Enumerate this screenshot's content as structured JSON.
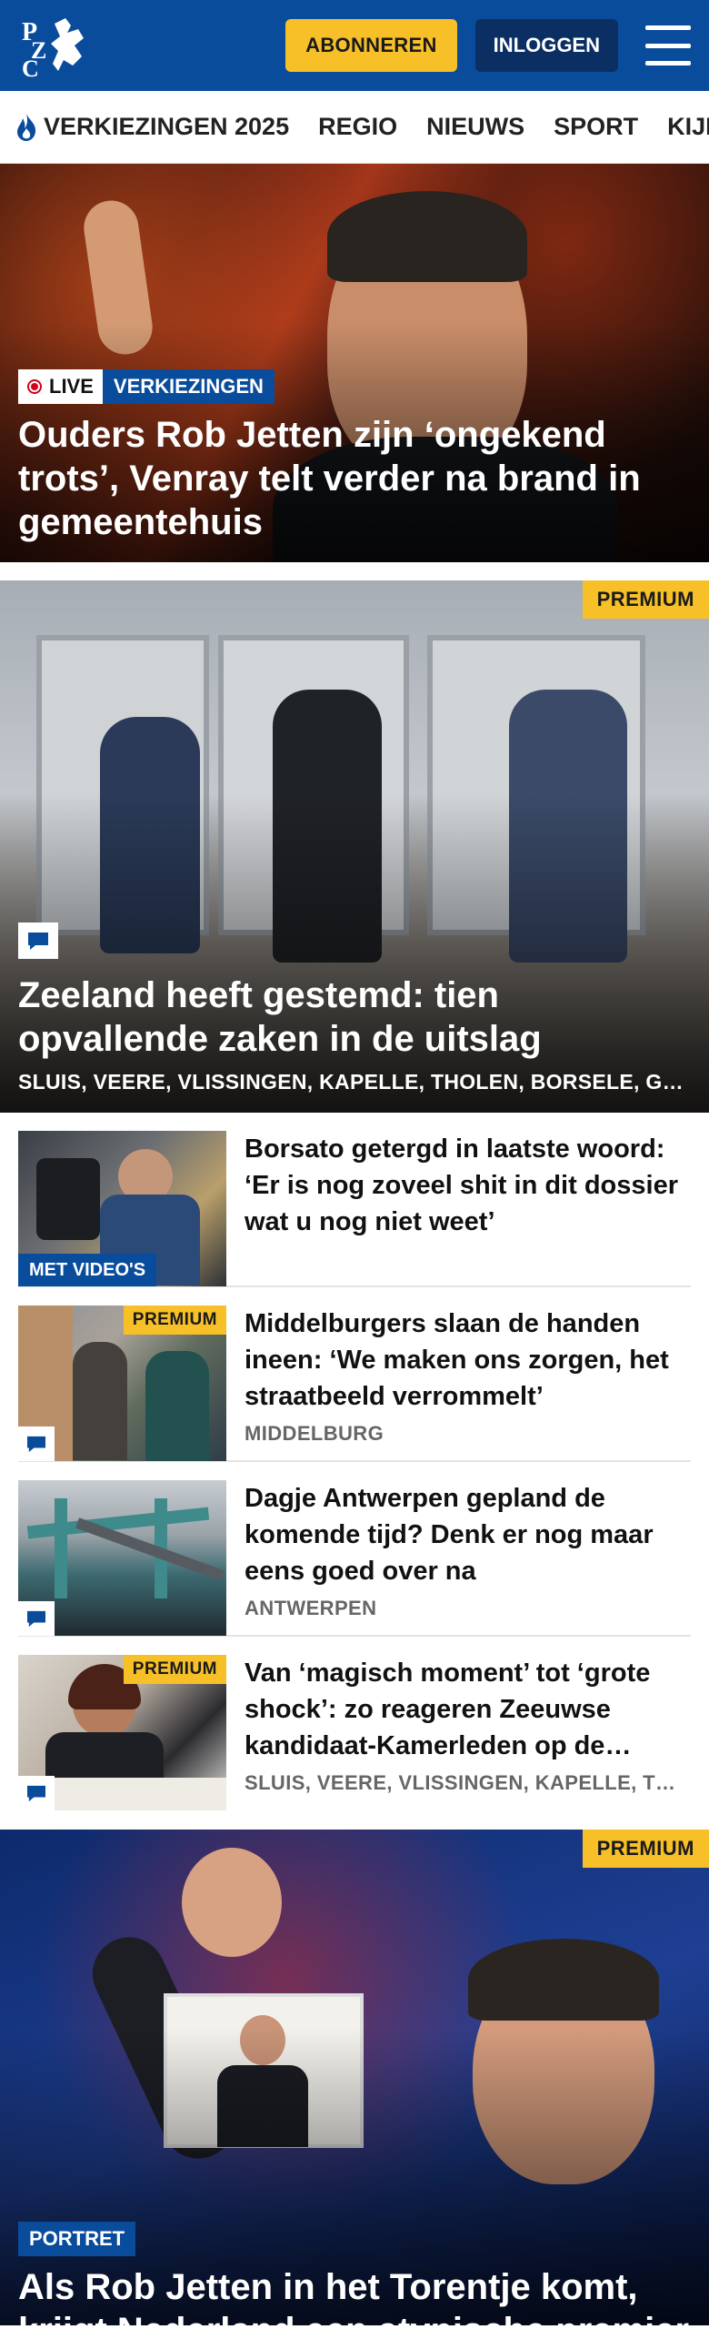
{
  "header": {
    "logo_text": "PZC",
    "subscribe_label": "ABONNEREN",
    "login_label": "INLOGGEN",
    "menu_icon": "hamburger-menu-icon",
    "brand_color": "#0a4c9c",
    "accent_color": "#f7c028"
  },
  "nav": {
    "items": [
      {
        "label": "VERKIEZINGEN 2025",
        "icon": "flame-icon"
      },
      {
        "label": "REGIO"
      },
      {
        "label": "NIEUWS"
      },
      {
        "label": "SPORT"
      },
      {
        "label": "KIJK"
      }
    ]
  },
  "hero1": {
    "live_label": "LIVE",
    "tag": "VERKIEZINGEN",
    "title": "Ouders Rob Jetten zijn ‘ongekend trots’, Venray telt verder na brand in gemeentehuis"
  },
  "hero2": {
    "premium_label": "PREMIUM",
    "title": "Zeeland heeft gestemd: tien opvallende zaken in de uitslag",
    "locations": "SLUIS, VEERE, VLISSINGEN, KAPELLE, THOLEN, BORSELE, GOES, MIDDELBURG"
  },
  "articles": [
    {
      "title": "Borsato getergd in laatste woord: ‘Er is nog zoveel shit in dit dossier wat u nog niet weet’",
      "badge": "MET VIDEO'S",
      "location": ""
    },
    {
      "title": "Middelburgers slaan de handen ineen: ‘We maken ons zorgen, het straatbeeld verrommelt’",
      "premium": "PREMIUM",
      "location": "MIDDELBURG"
    },
    {
      "title": "Dagje Antwerpen gepland de komende tijd? Denk er nog maar eens goed over na",
      "location": "ANTWERPEN"
    },
    {
      "title": "Van ‘magisch moment’ tot ‘grote shock’: zo reageren Zeeuwse kandidaat-Kamerleden op de uitslag",
      "premium": "PREMIUM",
      "location": "SLUIS, VEERE, VLISSINGEN, KAPELLE, THOLEN"
    }
  ],
  "hero3": {
    "premium_label": "PREMIUM",
    "tag": "PORTRET",
    "title": "Als Rob Jetten in het Torentje komt, krijgt Nederland een atypische premier"
  }
}
